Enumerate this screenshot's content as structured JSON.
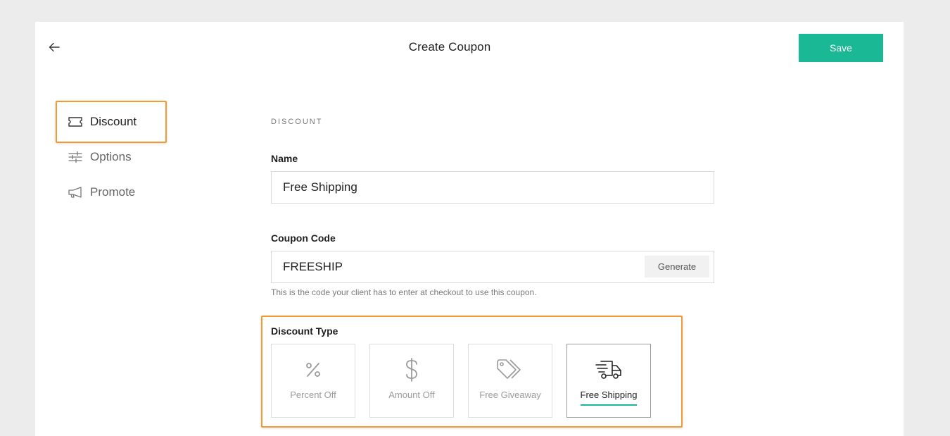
{
  "header": {
    "title": "Create Coupon",
    "save_label": "Save",
    "back_icon": "arrow-left-icon"
  },
  "sidebar": {
    "items": [
      {
        "label": "Discount",
        "icon": "ticket-icon",
        "active": true
      },
      {
        "label": "Options",
        "icon": "sliders-icon",
        "active": false
      },
      {
        "label": "Promote",
        "icon": "megaphone-icon",
        "active": false
      }
    ]
  },
  "form": {
    "section": "DISCOUNT",
    "name": {
      "label": "Name",
      "value": "Free Shipping"
    },
    "coupon_code": {
      "label": "Coupon Code",
      "value": "FREESHIP",
      "generate_label": "Generate",
      "help": "This is the code your client has to enter at checkout to use this coupon."
    },
    "discount_type": {
      "label": "Discount Type",
      "options": [
        {
          "label": "Percent Off",
          "icon": "percent-icon",
          "selected": false
        },
        {
          "label": "Amount Off",
          "icon": "dollar-icon",
          "selected": false
        },
        {
          "label": "Free Giveaway",
          "icon": "tags-icon",
          "selected": false
        },
        {
          "label": "Free Shipping",
          "icon": "delivery-truck-icon",
          "selected": true
        }
      ]
    }
  },
  "colors": {
    "accent": "#1ab894",
    "highlight": "#f39a33",
    "background": "#ececec"
  }
}
